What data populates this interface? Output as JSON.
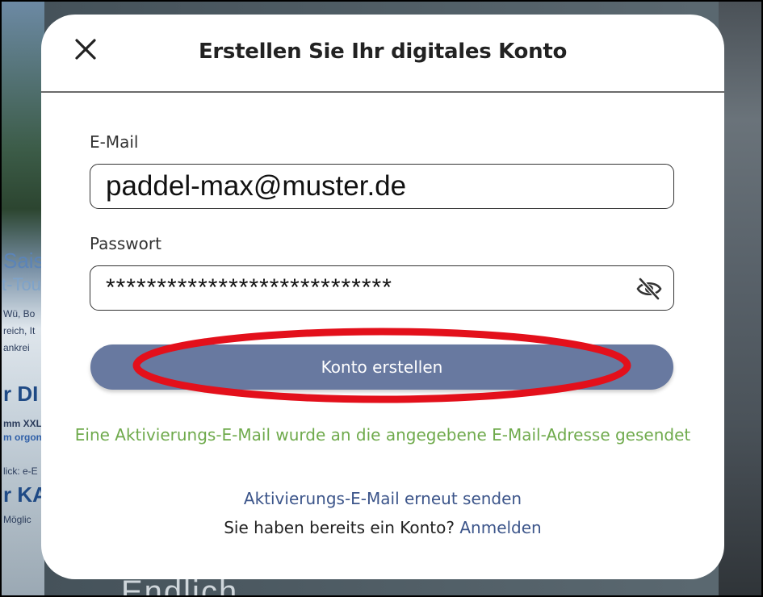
{
  "background": {
    "fragments": [
      "Sais",
      "t-Tou",
      "Wü, Bo",
      "reich, It",
      "ankrei",
      "r DI",
      "mm XXL",
      "m orgon",
      "lick: e-E",
      "r KA",
      "Möglic",
      "Endlich"
    ]
  },
  "modal": {
    "title": "Erstellen Sie Ihr digitales Konto",
    "close_icon": "close-icon"
  },
  "form": {
    "email_label": "E-Mail",
    "email_value": "paddel-max@muster.de",
    "password_label": "Passwort",
    "password_value": "****************************",
    "password_toggle_icon": "eye-slash-icon",
    "submit_label": "Konto erstellen"
  },
  "status": {
    "success_message": "Eine Aktivierungs-E-Mail wurde an die angegebene E-Mail-Adresse gesendet",
    "resend_label": "Aktivierungs-E-Mail erneut senden",
    "existing_account_text": "Sie haben bereits ein Konto?",
    "login_label": "Anmelden"
  },
  "colors": {
    "button": "#6879a0",
    "success": "#6faa4c",
    "link": "#3c558a",
    "highlight": "#e3101b"
  }
}
